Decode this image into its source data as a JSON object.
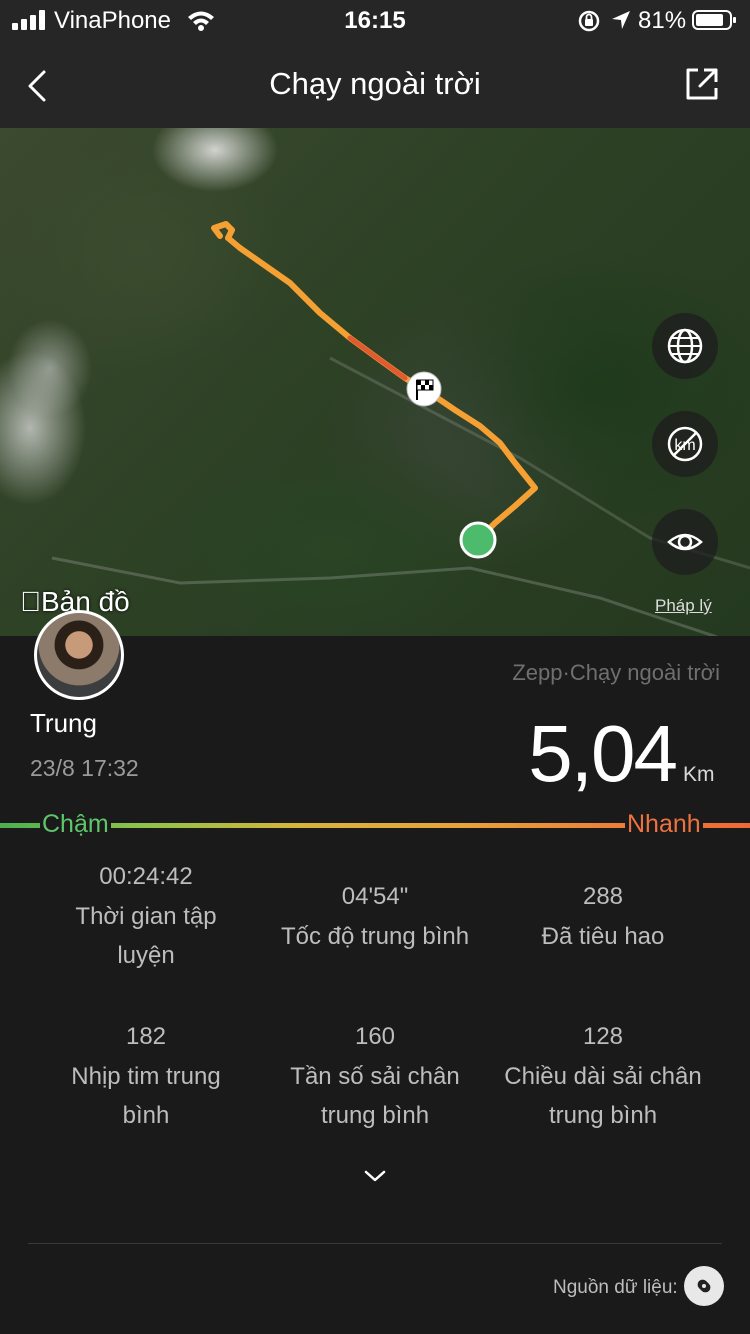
{
  "status_bar": {
    "carrier": "VinaPhone",
    "time": "16:15",
    "battery": "81%"
  },
  "nav": {
    "title": "Chạy ngoài trời"
  },
  "map": {
    "provider_label": "Bản đồ",
    "legal_link": "Pháp lý",
    "route_color": "#f5a033",
    "start_marker_color": "#4cbb6c"
  },
  "workout": {
    "user_name": "Trung",
    "date": "23/8 17:32",
    "source_line": "Zepp·Chạy ngoài trời",
    "distance_value": "5,04",
    "distance_unit": "Km"
  },
  "pace_scale": {
    "slow_label": "Chậm",
    "fast_label": "Nhanh"
  },
  "stats": [
    {
      "value": "00:24:42",
      "label_1": "Thời gian tập",
      "label_2": "luyện"
    },
    {
      "value": "04'54\"",
      "label_1": "Tốc độ trung bình",
      "label_2": ""
    },
    {
      "value": "288",
      "label_1": "Đã tiêu hao",
      "label_2": ""
    },
    {
      "value": "182",
      "label_1": "Nhịp tim trung",
      "label_2": "bình"
    },
    {
      "value": "160",
      "label_1": "Tần số sải chân",
      "label_2": "trung bình"
    },
    {
      "value": "128",
      "label_1": "Chiều dài sải chân",
      "label_2": "trung bình"
    }
  ],
  "footer": {
    "data_source_label": "Nguồn dữ liệu:"
  }
}
